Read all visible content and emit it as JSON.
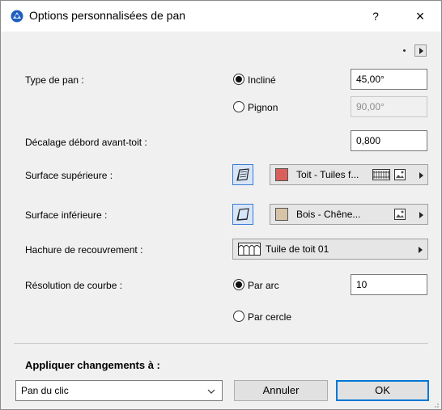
{
  "window": {
    "title": "Options personnalisées de pan",
    "help": "?",
    "close": "×"
  },
  "type_de_pan": {
    "label": "Type de pan :",
    "incline_label": "Incliné",
    "incline_value": "45,00°",
    "pignon_label": "Pignon",
    "pignon_value": "90,00°"
  },
  "decalage": {
    "label": "Décalage débord avant-toit :",
    "value": "0,800"
  },
  "surface_sup": {
    "label": "Surface supérieure :",
    "material": "Toit - Tuiles f...",
    "swatch_color": "#d9605a"
  },
  "surface_inf": {
    "label": "Surface inférieure :",
    "material": "Bois - Chêne...",
    "swatch_color": "#d6c3a8"
  },
  "hachure": {
    "label": "Hachure de recouvrement :",
    "value": "Tuile de toit 01"
  },
  "resolution": {
    "label": "Résolution de courbe :",
    "par_arc_label": "Par arc",
    "par_arc_value": "10",
    "par_cercle_label": "Par cercle"
  },
  "appliquer": {
    "label": "Appliquer changements à :",
    "selected": "Pan du clic"
  },
  "buttons": {
    "cancel": "Annuler",
    "ok": "OK"
  },
  "colors": {
    "accent": "#0078d7",
    "icon_button_bg": "#d7e6f7"
  }
}
